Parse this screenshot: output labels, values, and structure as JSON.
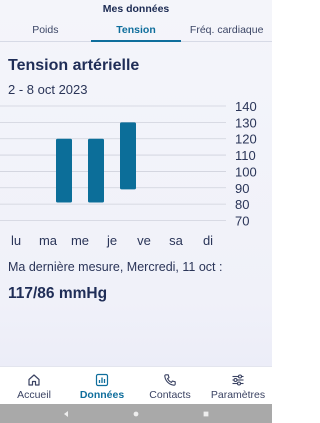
{
  "header": {
    "title": "Mes données"
  },
  "tabs": [
    {
      "label": "Poids",
      "active": false
    },
    {
      "label": "Tension",
      "active": true
    },
    {
      "label": "Fréq. cardiaque",
      "active": false
    }
  ],
  "section": {
    "title": "Tension artérielle",
    "date_range": "2 - 8 oct 2023"
  },
  "chart_data": {
    "type": "bar",
    "categories": [
      "lu",
      "ma",
      "me",
      "je",
      "ve",
      "sa",
      "di"
    ],
    "series": [
      {
        "low": [
          null,
          81,
          81,
          89,
          null,
          null,
          null
        ],
        "high": [
          null,
          120,
          120,
          130,
          null,
          null,
          null
        ]
      }
    ],
    "yticks": [
      70,
      80,
      90,
      100,
      110,
      120,
      130,
      140
    ],
    "ylim": [
      70,
      140
    ],
    "grid": true,
    "bar_color": "#0c6e99"
  },
  "last_measure": {
    "label": "Ma dernière mesure, Mercredi, 11 oct :",
    "value": "117/86 mmHg"
  },
  "nav": [
    {
      "label": "Accueil",
      "icon": "home-icon",
      "active": false
    },
    {
      "label": "Données",
      "icon": "chart-icon",
      "active": true
    },
    {
      "label": "Contacts",
      "icon": "phone-icon",
      "active": false
    },
    {
      "label": "Paramètres",
      "icon": "sliders-icon",
      "active": false
    }
  ],
  "colors": {
    "accent": "#0f6e9c",
    "text": "#1f2d57"
  }
}
